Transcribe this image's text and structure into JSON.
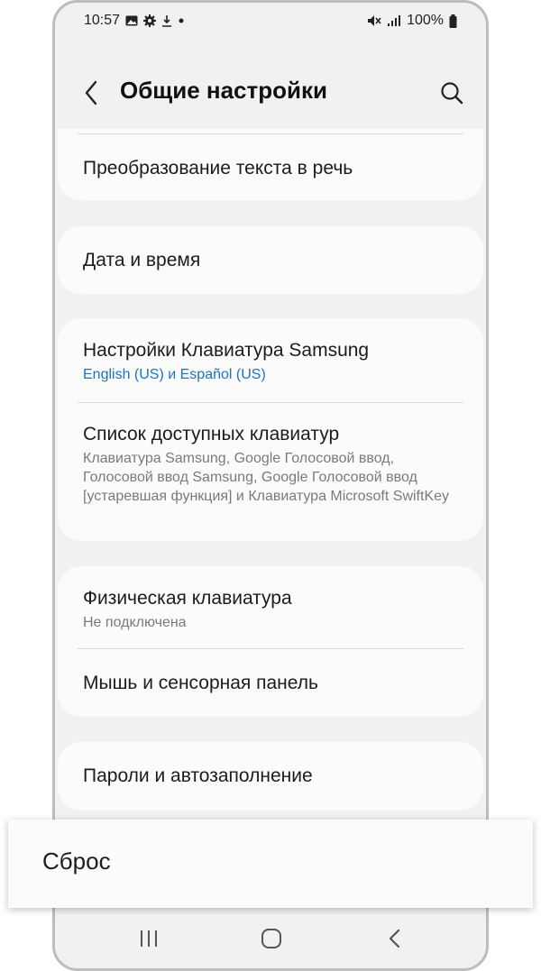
{
  "status_bar": {
    "time": "10:57",
    "battery": "100%",
    "left_icons": [
      "image-icon",
      "gear-icon",
      "download-icon",
      "dot-icon"
    ],
    "right_icons": [
      "mute-icon",
      "signal-icon",
      "battery-icon"
    ]
  },
  "header": {
    "title": "Общие настройки",
    "back_icon": "chevron-left-icon",
    "search_icon": "search-icon"
  },
  "items": {
    "tts": {
      "title": "Преобразование текста в речь"
    },
    "datetime": {
      "title": "Дата и время"
    },
    "samsung_keyboard": {
      "title": "Настройки Клавиатура Samsung",
      "subtitle": "English (US) и Español (US)"
    },
    "keyboard_list": {
      "title": "Список доступных клавиатур",
      "subtitle": "Клавиатура Samsung, Google Голосовой ввод, Голосовой ввод Samsung, Google Голосовой ввод [устаревшая функция] и Клавиатура Microsoft SwiftKey"
    },
    "physical_keyboard": {
      "title": "Физическая клавиатура",
      "subtitle": "Не подключена"
    },
    "mouse_touchpad": {
      "title": "Мышь и сенсорная панель"
    },
    "passwords": {
      "title": "Пароли и автозаполнение"
    }
  },
  "reset": {
    "label": "Сброс"
  },
  "nav": {
    "recents_icon": "recents-icon",
    "home_icon": "home-icon",
    "back_icon": "back-icon"
  },
  "colors": {
    "link_blue": "#1a73c9",
    "background": "#f1f1f1",
    "card": "#fbfbfb"
  }
}
